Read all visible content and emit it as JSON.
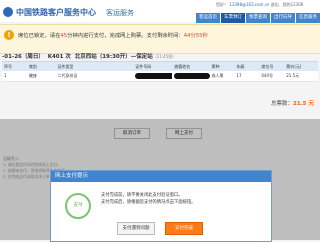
{
  "header": {
    "logo_text": "中国铁路客户服务中心",
    "logo_subtitle": "客运服务",
    "welcome_prefix": "您好！",
    "user_email": "11398@163.com.cn",
    "welcome_links": "退出",
    "helpbox": "我的12306",
    "nav": [
      "客运首页",
      "车票预订",
      "余票查询",
      "出行向导",
      "信息服务"
    ]
  },
  "notice": {
    "text_before": "席位已锁定，请在",
    "minutes": "45",
    "text_middle": "分钟内进行支付，完成网上购票。支付剩余时间：",
    "countdown": "44分55秒",
    "icon": "!"
  },
  "trip": {
    "date": "-01-26（周日）",
    "train": "K401 次",
    "route": "北京西站（19:30开）—保定站",
    "arrive": "（21:45到）"
  },
  "table": {
    "headers": [
      "序号",
      "席别",
      "证件类型",
      "证件号码",
      "旅客姓名",
      "票种",
      "车厢",
      "席位号",
      "票价(元)"
    ],
    "rows": [
      {
        "cells": [
          "1",
          "硬座",
          "二代身份证",
          "",
          "",
          "成人票",
          "17",
          "044号",
          "21.5元"
        ]
      }
    ]
  },
  "total": {
    "label": "总票款：",
    "amount": "21.5 元"
  },
  "buttons": {
    "cancel": "取消订单",
    "pay": "网上支付"
  },
  "tips": [
    "温馨提示：",
    "1. 请在规定时间内完成网上支付。",
    "2. 逾期未支付，系统将取消本次交易。",
    "3. 在完成支付或取消本订单之前，您将无法..."
  ],
  "modal": {
    "title": "网上支付提示",
    "icon_text": "支付",
    "line1": "支付完成前，请不要关闭此支付验证窗口。",
    "line2": "支付完成后，请根据您支付的情况点击下面按钮。",
    "btn_problem": "支付遇到问题",
    "btn_done": "支付完成"
  }
}
